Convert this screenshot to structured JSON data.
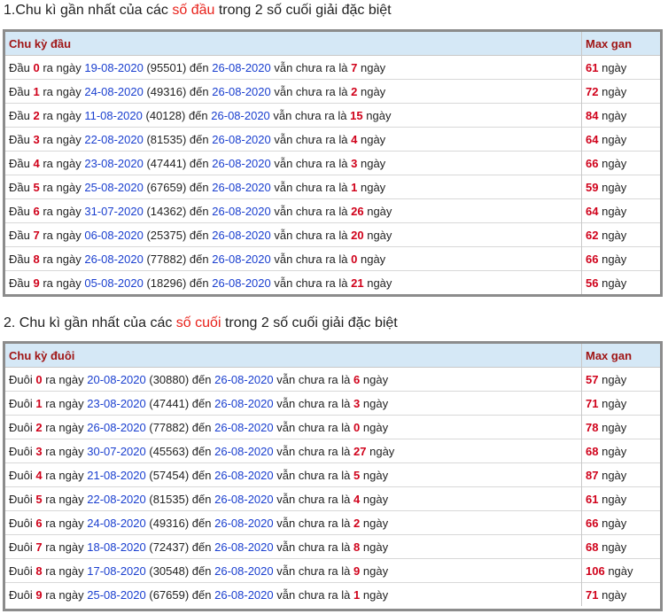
{
  "section1": {
    "title_prefix": "1.Chu kì gần nhất của các ",
    "title_highlight": "số đầu",
    "title_suffix": " trong 2 số cuối giải đặc biệt",
    "col1": "Chu kỳ đầu",
    "col2": "Max gan",
    "rows": [
      {
        "label": "Đầu",
        "digit": "0",
        "date": "19-08-2020",
        "code": "(95501)",
        "end": "26-08-2020",
        "days": "7",
        "max": "61"
      },
      {
        "label": "Đầu",
        "digit": "1",
        "date": "24-08-2020",
        "code": "(49316)",
        "end": "26-08-2020",
        "days": "2",
        "max": "72"
      },
      {
        "label": "Đầu",
        "digit": "2",
        "date": "11-08-2020",
        "code": "(40128)",
        "end": "26-08-2020",
        "days": "15",
        "max": "84"
      },
      {
        "label": "Đầu",
        "digit": "3",
        "date": "22-08-2020",
        "code": "(81535)",
        "end": "26-08-2020",
        "days": "4",
        "max": "64"
      },
      {
        "label": "Đầu",
        "digit": "4",
        "date": "23-08-2020",
        "code": "(47441)",
        "end": "26-08-2020",
        "days": "3",
        "max": "66"
      },
      {
        "label": "Đầu",
        "digit": "5",
        "date": "25-08-2020",
        "code": "(67659)",
        "end": "26-08-2020",
        "days": "1",
        "max": "59"
      },
      {
        "label": "Đầu",
        "digit": "6",
        "date": "31-07-2020",
        "code": "(14362)",
        "end": "26-08-2020",
        "days": "26",
        "max": "64"
      },
      {
        "label": "Đầu",
        "digit": "7",
        "date": "06-08-2020",
        "code": "(25375)",
        "end": "26-08-2020",
        "days": "20",
        "max": "62"
      },
      {
        "label": "Đầu",
        "digit": "8",
        "date": "26-08-2020",
        "code": "(77882)",
        "end": "26-08-2020",
        "days": "0",
        "max": "66"
      },
      {
        "label": "Đầu",
        "digit": "9",
        "date": "05-08-2020",
        "code": "(18296)",
        "end": "26-08-2020",
        "days": "21",
        "max": "56"
      }
    ]
  },
  "section2": {
    "title_prefix": "2. Chu kì gần nhất của các ",
    "title_highlight": "số cuối",
    "title_suffix": " trong 2 số cuối giải đặc biệt",
    "col1": "Chu kỳ đuôi",
    "col2": "Max gan",
    "rows": [
      {
        "label": "Đuôi",
        "digit": "0",
        "date": "20-08-2020",
        "code": "(30880)",
        "end": "26-08-2020",
        "days": "6",
        "max": "57"
      },
      {
        "label": "Đuôi",
        "digit": "1",
        "date": "23-08-2020",
        "code": "(47441)",
        "end": "26-08-2020",
        "days": "3",
        "max": "71"
      },
      {
        "label": "Đuôi",
        "digit": "2",
        "date": "26-08-2020",
        "code": "(77882)",
        "end": "26-08-2020",
        "days": "0",
        "max": "78"
      },
      {
        "label": "Đuôi",
        "digit": "3",
        "date": "30-07-2020",
        "code": "(45563)",
        "end": "26-08-2020",
        "days": "27",
        "max": "68"
      },
      {
        "label": "Đuôi",
        "digit": "4",
        "date": "21-08-2020",
        "code": "(57454)",
        "end": "26-08-2020",
        "days": "5",
        "max": "87"
      },
      {
        "label": "Đuôi",
        "digit": "5",
        "date": "22-08-2020",
        "code": "(81535)",
        "end": "26-08-2020",
        "days": "4",
        "max": "61"
      },
      {
        "label": "Đuôi",
        "digit": "6",
        "date": "24-08-2020",
        "code": "(49316)",
        "end": "26-08-2020",
        "days": "2",
        "max": "66"
      },
      {
        "label": "Đuôi",
        "digit": "7",
        "date": "18-08-2020",
        "code": "(72437)",
        "end": "26-08-2020",
        "days": "8",
        "max": "68"
      },
      {
        "label": "Đuôi",
        "digit": "8",
        "date": "17-08-2020",
        "code": "(30548)",
        "end": "26-08-2020",
        "days": "9",
        "max": "106"
      },
      {
        "label": "Đuôi",
        "digit": "9",
        "date": "25-08-2020",
        "code": "(67659)",
        "end": "26-08-2020",
        "days": "1",
        "max": "71"
      }
    ]
  },
  "text": {
    "ra_ngay": "ra ngày",
    "den": "đến",
    "van_chua": "vẫn chưa ra là",
    "ngay": "ngày"
  },
  "colors": {
    "highlight": "#e8221b",
    "number": "#d0021b",
    "date": "#1a3fcf",
    "header_bg": "#d5e8f6",
    "header_text": "#a01616"
  }
}
